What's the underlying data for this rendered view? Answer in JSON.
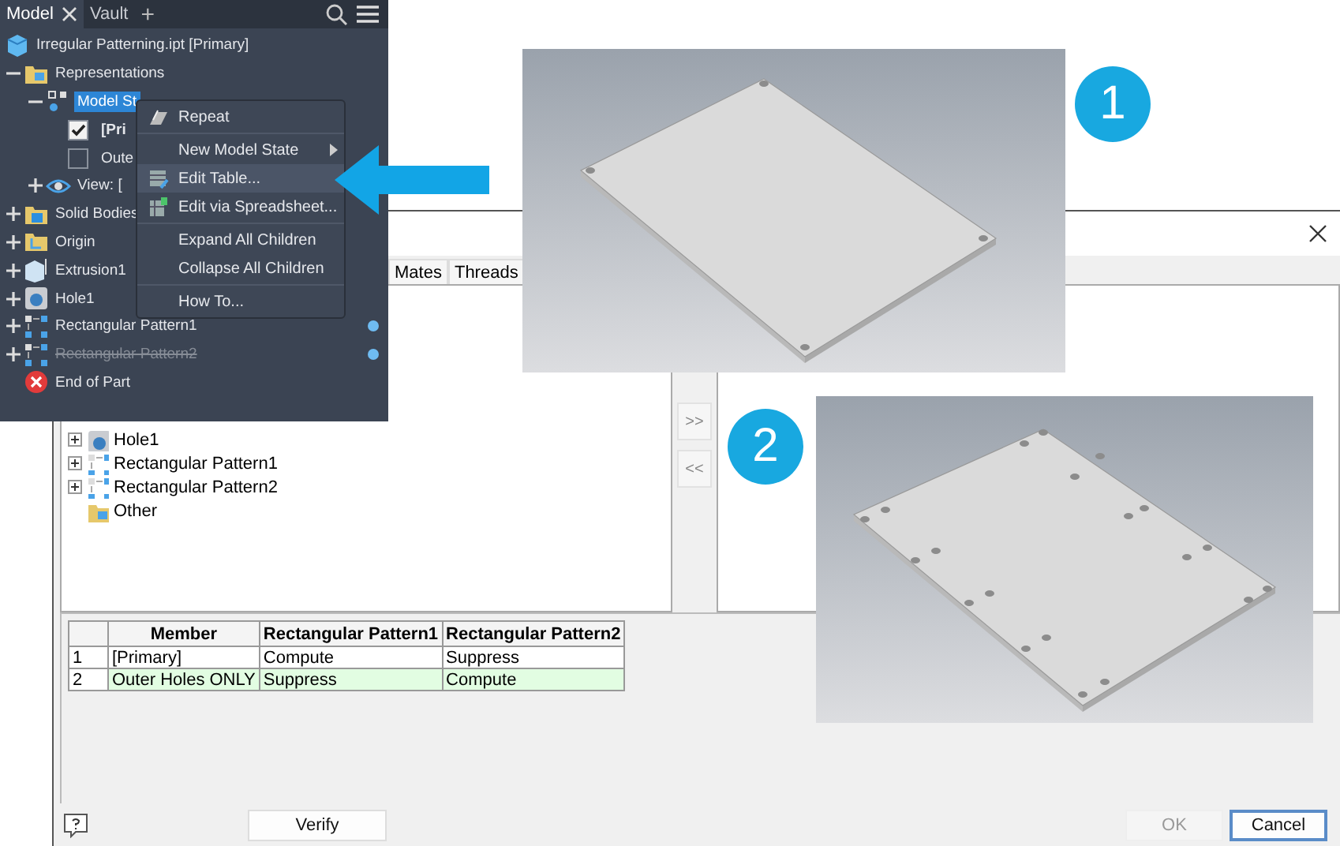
{
  "browser": {
    "tabs": [
      {
        "label": "Model",
        "selected": true,
        "closable": true
      },
      {
        "label": "Vault",
        "selected": false,
        "closable": false
      }
    ],
    "add_tab": "+",
    "root": {
      "label": "Irregular Patterning.ipt [Primary]",
      "kind": "part",
      "children": [
        {
          "label": "Representations",
          "kind": "folder",
          "expanded": true,
          "children": [
            {
              "label": "Model St",
              "kind": "state",
              "expanded": true,
              "selected": true,
              "children": [
                {
                  "label": "[Pri",
                  "kind": "check",
                  "checked": true,
                  "bold": true
                },
                {
                  "label": "Oute",
                  "kind": "check",
                  "checked": false
                }
              ]
            },
            {
              "label": "View: [",
              "kind": "view",
              "expanded": false
            }
          ]
        },
        {
          "label": "Solid Bodies",
          "kind": "bodies",
          "expanded": false
        },
        {
          "label": "Origin",
          "kind": "origin",
          "expanded": false
        },
        {
          "label": "Extrusion1",
          "kind": "extrude",
          "expanded": false
        },
        {
          "label": "Hole1",
          "kind": "hole",
          "expanded": false
        },
        {
          "label": "Rectangular Pattern1",
          "kind": "pattern",
          "expanded": false,
          "marked": true
        },
        {
          "label": "Rectangular Pattern2",
          "kind": "pattern",
          "expanded": false,
          "marked": true,
          "suppressed": true
        },
        {
          "label": "End of Part",
          "kind": "end"
        }
      ]
    }
  },
  "menu": {
    "groups": [
      [
        {
          "label": "Repeat",
          "kind": "repeat",
          "selected": false
        }
      ],
      [
        {
          "label": "New Model State",
          "submenu": true,
          "selected": false
        },
        {
          "label": "Edit Table...",
          "kind": "table",
          "selected": true
        },
        {
          "label": "Edit via Spreadsheet...",
          "kind": "sheet",
          "selected": false
        }
      ],
      [
        {
          "label": "Expand All Children",
          "selected": false
        },
        {
          "label": "Collapse All Children",
          "selected": false
        }
      ],
      [
        {
          "label": "How To...",
          "selected": false
        }
      ]
    ]
  },
  "dialog": {
    "tabs": [
      {
        "label": "Mates",
        "selected": false
      },
      {
        "label": "Threads",
        "selected": false
      }
    ],
    "tree": [
      {
        "label": "Hole1",
        "kind": "hole"
      },
      {
        "label": "Rectangular Pattern1",
        "kind": "pattern"
      },
      {
        "label": "Rectangular Pattern2",
        "kind": "pattern"
      },
      {
        "label": "Other",
        "kind": "folder"
      }
    ],
    "move_buttons": [
      ">>",
      "<<"
    ],
    "table": {
      "columns": [
        "",
        "Member",
        "Rectangular Pattern1",
        "Rectangular Pattern2"
      ],
      "rows": [
        {
          "cells": [
            "1",
            "[Primary]",
            "Compute",
            "Suppress"
          ],
          "selected": false
        },
        {
          "cells": [
            "2",
            "Outer Holes ONLY",
            "Suppress",
            "Compute"
          ],
          "selected": true
        }
      ]
    },
    "buttons": [
      {
        "label": "Verify",
        "kind": "verify",
        "disabled": false
      },
      {
        "label": "OK",
        "kind": "ok",
        "disabled": true
      },
      {
        "label": "Cancel",
        "kind": "cancel",
        "disabled": false,
        "default": true
      }
    ]
  },
  "callouts": [
    "1",
    "2"
  ]
}
